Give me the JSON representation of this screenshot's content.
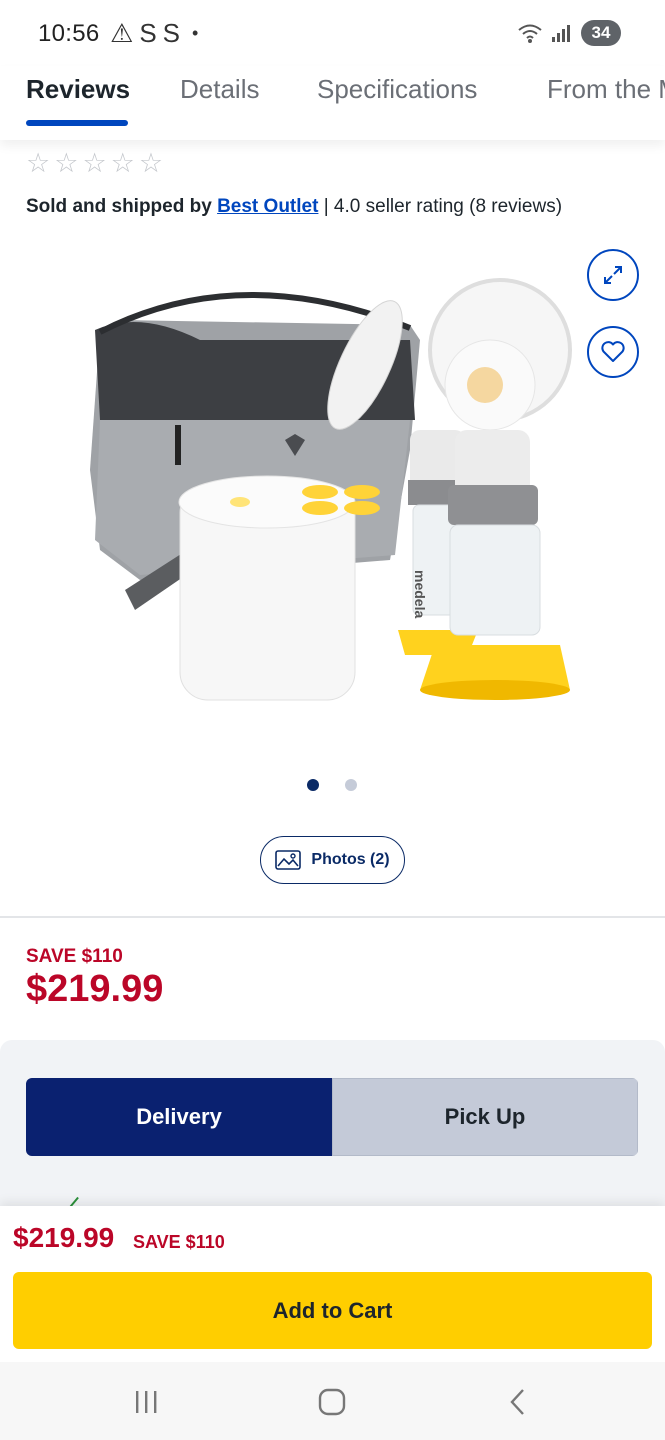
{
  "status_bar": {
    "time": "10:56",
    "left_glyphs": [
      "⚠",
      "S",
      "S"
    ],
    "dot": "•",
    "battery": "34"
  },
  "tabs": [
    {
      "label": "Reviews",
      "active": true
    },
    {
      "label": "Details",
      "active": false
    },
    {
      "label": "Specifications",
      "active": false
    },
    {
      "label": "From the Manufacturer",
      "active": false
    }
  ],
  "rating": {
    "stars_filled": 0,
    "stars_total": 5,
    "star_glyph": "☆"
  },
  "seller": {
    "prefix": "Sold and shipped by",
    "name": "Best Outlet",
    "rating_text": "| 4.0 seller rating (8 reviews)"
  },
  "gallery": {
    "current_index": 1,
    "total": 2,
    "photos_label": "Photos (2)",
    "brand_text": "medela",
    "icons": [
      "expand-icon",
      "heart-icon",
      "photo-icon"
    ]
  },
  "pricing": {
    "save_label": "SAVE $110",
    "price": "$219.99"
  },
  "fulfillment": {
    "delivery_label": "Delivery",
    "pickup_label": "Pick Up",
    "selected": "Delivery"
  },
  "sticky_bar": {
    "price": "$219.99",
    "save_label": "SAVE $110",
    "add_to_cart_label": "Add to Cart"
  },
  "colors": {
    "accent_blue": "#0046be",
    "dark_navy": "#0a2170",
    "sale_red": "#bb0628",
    "cart_yellow": "#ffce00"
  }
}
